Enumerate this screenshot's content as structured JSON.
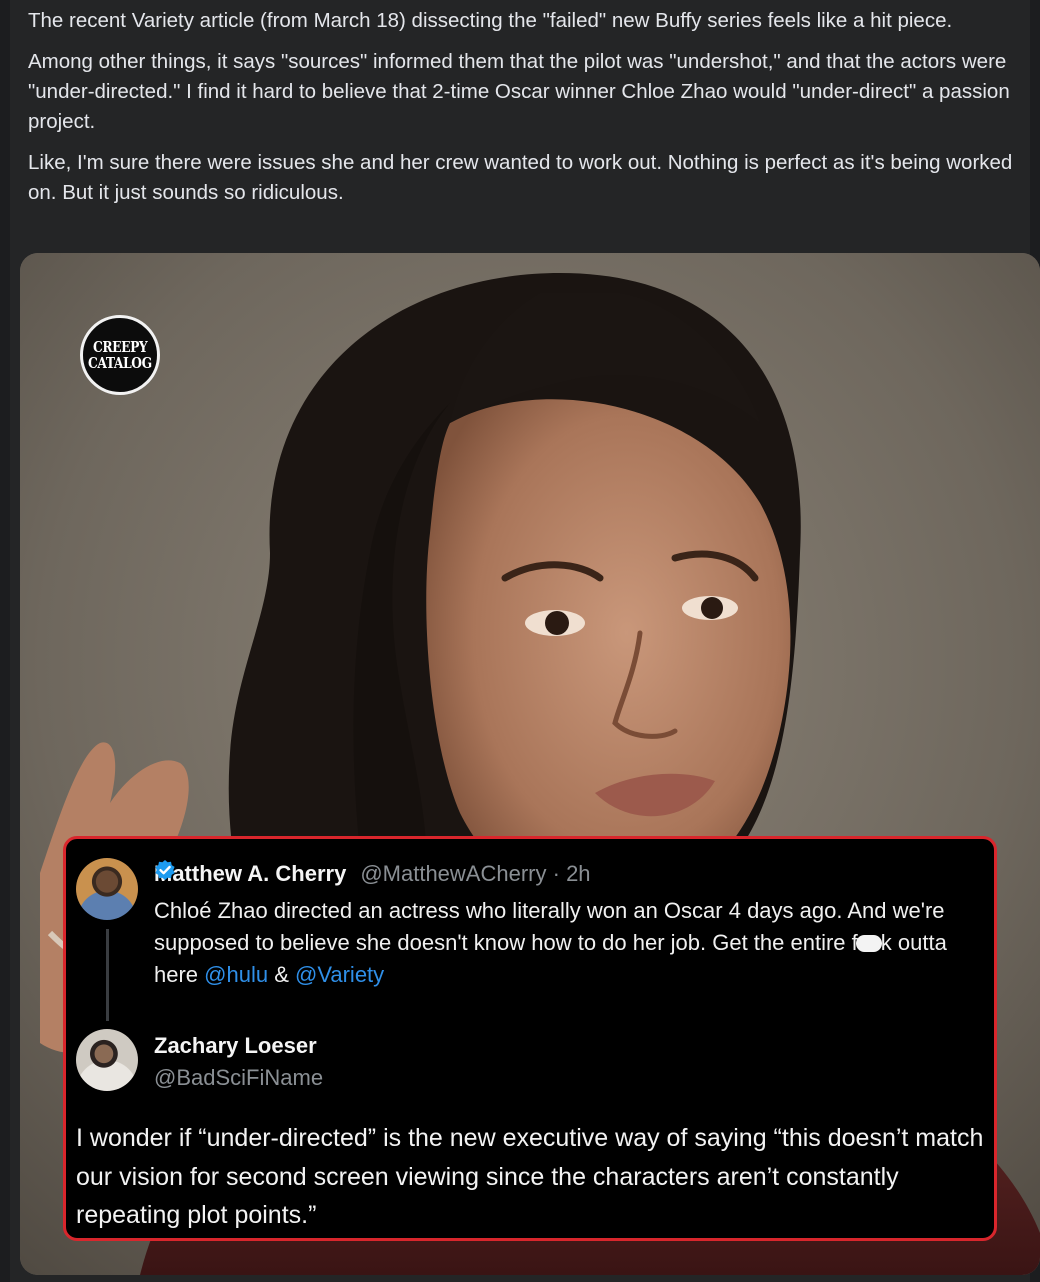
{
  "post": {
    "paragraphs": [
      "The recent Variety article (from March 18) dissecting the \"failed\" new Buffy series feels like a hit piece.",
      "Among other things, it says \"sources\" informed them that the pilot was \"undershot,\" and that the actors were \"under-directed.\" I find it hard to believe that 2-time Oscar winner Chloe Zhao would \"under-direct\" a passion project.",
      "Like, I'm sure there were issues she and her crew wanted to work out. Nothing is perfect as it's being worked on. But it just sounds so ridiculous."
    ]
  },
  "image": {
    "logo_lines": [
      "CREEPY",
      "CATALOG"
    ],
    "tweet1": {
      "name": "Matthew A. Cherry",
      "handle": "@MatthewACherry",
      "time": "· 2h",
      "verified_icon": "verified-badge-icon",
      "text_1": "Chloé Zhao directed an actress who literally won an Oscar 4 days ago. And we're supposed to believe she doesn't know how to do her job. Get the entire f",
      "text_2": "k outta here ",
      "mention_1": "@hulu",
      "text_3": " & ",
      "mention_2": "@Variety"
    },
    "tweet2": {
      "name": "Zachary Loeser",
      "handle": "@BadSciFiName",
      "text": "I wonder if “under-directed” is the new executive way of saying “this doesn’t match our vision for second screen viewing since the characters aren’t constantly repeating plot points.”"
    },
    "colors": {
      "highlight_border": "#d9262c",
      "mention_blue": "#2f8fe8",
      "verified_blue": "#1d9bf0"
    }
  }
}
